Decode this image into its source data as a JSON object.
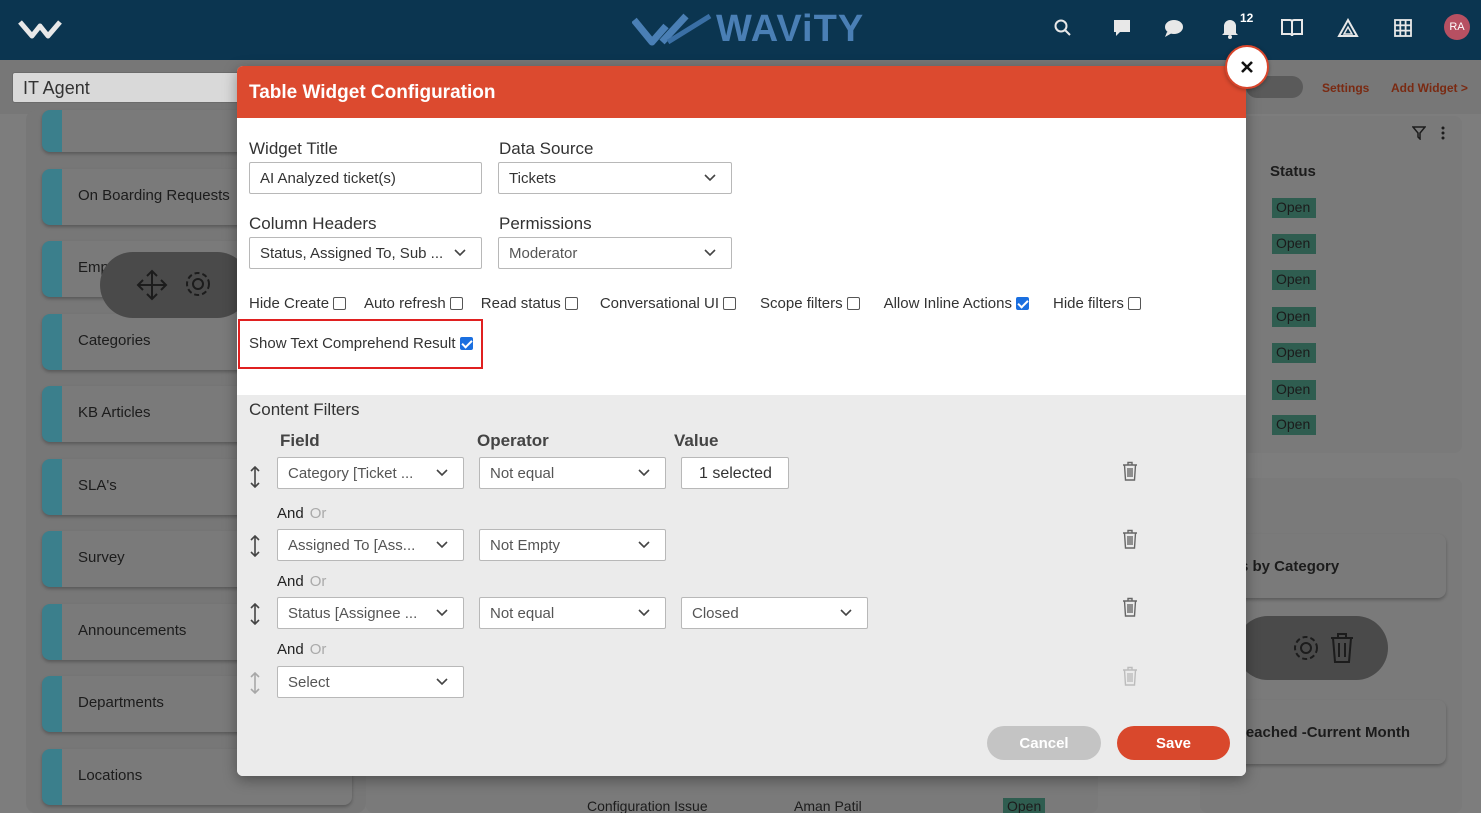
{
  "topbar": {
    "brand": "WAViTY",
    "notifications_count": "12",
    "avatar_initials": "RA"
  },
  "subbar": {
    "agent": "IT Agent",
    "settings_link": "Settings",
    "add_widget_link": "Add Widget >"
  },
  "sidebar": {
    "items": [
      "On Boarding Requests",
      "Emp",
      "Categories",
      "KB Articles",
      "SLA's",
      "Survey",
      "Announcements",
      "Departments",
      "Locations"
    ]
  },
  "right_panel": {
    "column_header": "Status",
    "statuses": [
      "Open",
      "Open",
      "Open",
      "Open",
      "Open",
      "Open",
      "Open"
    ],
    "cards": [
      "s by Category",
      "reached -Current Month"
    ]
  },
  "background_row": {
    "subject": "Configuration Issue",
    "assignee": "Aman Patil",
    "status": "Open"
  },
  "modal": {
    "title": "Table Widget Configuration",
    "widget_title_label": "Widget Title",
    "widget_title_value": "AI Analyzed ticket(s)",
    "data_source_label": "Data Source",
    "data_source_value": "Tickets",
    "column_headers_label": "Column Headers",
    "column_headers_value": "Status, Assigned To, Sub ...",
    "permissions_label": "Permissions",
    "permissions_value": "Moderator",
    "checkboxes": [
      {
        "label": "Hide Create",
        "checked": false
      },
      {
        "label": "Auto refresh",
        "checked": false
      },
      {
        "label": "Read status",
        "checked": false
      },
      {
        "label": "Conversational UI",
        "checked": false
      },
      {
        "label": "Scope filters",
        "checked": false
      },
      {
        "label": "Allow Inline Actions",
        "checked": true
      },
      {
        "label": "Hide filters",
        "checked": false
      }
    ],
    "show_text_comprehend_label": "Show Text Comprehend Result",
    "show_text_comprehend_checked": true,
    "content_filters_label": "Content Filters",
    "filter_headers": {
      "field": "Field",
      "operator": "Operator",
      "value": "Value"
    },
    "filters": [
      {
        "field": "Category [Ticket ...",
        "operator": "Not equal",
        "value": "1 selected"
      },
      {
        "field": "Assigned To [Ass...",
        "operator": "Not Empty",
        "value": ""
      },
      {
        "field": "Status [Assignee ...",
        "operator": "Not equal",
        "value": "Closed"
      },
      {
        "field": "Select",
        "operator": "",
        "value": ""
      }
    ],
    "and_label": "And",
    "or_label": "Or",
    "cancel_label": "Cancel",
    "save_label": "Save"
  },
  "colors": {
    "navbar": "#0b3550",
    "modal_header": "#dc4a2f",
    "save_button": "#d9482c",
    "cancel_button": "#c4c4c4",
    "checkbox_checked": "#1a6fe0"
  }
}
